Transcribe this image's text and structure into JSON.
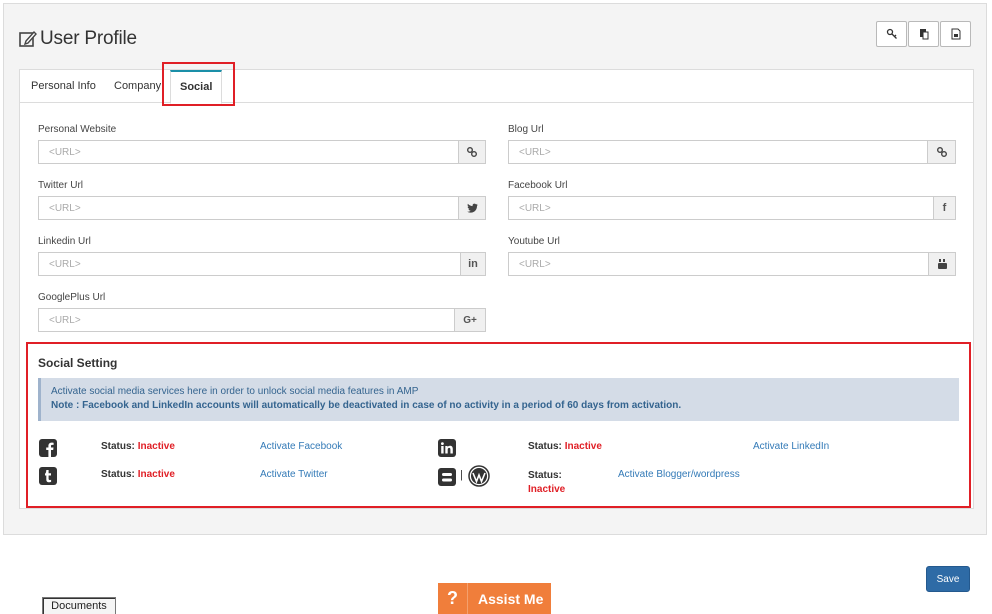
{
  "page": {
    "title": "User Profile"
  },
  "toolbar": {
    "buttons": [
      "key-icon",
      "copy-icon",
      "image-file-icon"
    ]
  },
  "tabs": [
    {
      "label": "Personal Info",
      "active": false
    },
    {
      "label": "Company",
      "active": false
    },
    {
      "label": "Social",
      "active": true
    }
  ],
  "fields": {
    "personal_website": {
      "label": "Personal Website",
      "placeholder": "<URL>",
      "icon": "link-icon"
    },
    "blog_url": {
      "label": "Blog Url",
      "placeholder": "<URL>",
      "icon": "link-icon"
    },
    "twitter_url": {
      "label": "Twitter Url",
      "placeholder": "<URL>",
      "icon": "twitter-icon"
    },
    "facebook_url": {
      "label": "Facebook Url",
      "placeholder": "<URL>",
      "icon": "facebook-icon"
    },
    "linkedin_url": {
      "label": "Linkedin Url",
      "placeholder": "<URL>",
      "icon": "linkedin-icon"
    },
    "youtube_url": {
      "label": "Youtube Url",
      "placeholder": "<URL>",
      "icon": "youtube-icon"
    },
    "googleplus_url": {
      "label": "GooglePlus Url",
      "placeholder": "<URL>",
      "icon": "google-plus-icon"
    }
  },
  "social_setting": {
    "title": "Social Setting",
    "info_line1": "Activate social media services here in order to unlock social media features in AMP",
    "info_line2": "Note : Facebook and LinkedIn accounts will automatically be deactivated in case of no activity in a period of 60 days from activation.",
    "status_label": "Status:",
    "services": [
      {
        "name": "Facebook",
        "status": "Inactive",
        "link": "Activate Facebook",
        "icon": "facebook-square-icon"
      },
      {
        "name": "LinkedIn",
        "status": "Inactive",
        "link": "Activate LinkedIn",
        "icon": "linkedin-square-icon"
      },
      {
        "name": "Twitter",
        "status": "Inactive",
        "link": "Activate Twitter",
        "icon": "tumblr-square-icon"
      },
      {
        "name": "Blogger/wordpress",
        "status": "Inactive",
        "link": "Activate Blogger/wordpress",
        "icon": "blogger-wordpress-icon"
      }
    ],
    "separator": "|"
  },
  "actions": {
    "save_label": "Save"
  },
  "assist": {
    "q_label": "?",
    "label": "Assist Me"
  },
  "documents": {
    "label": "Documents"
  },
  "colors": {
    "accent": "#1a8fa8",
    "highlight_red": "#e01f26",
    "save_blue": "#2e6ba6",
    "assist_orange": "#f07e3b",
    "link_blue": "#337ab7"
  }
}
